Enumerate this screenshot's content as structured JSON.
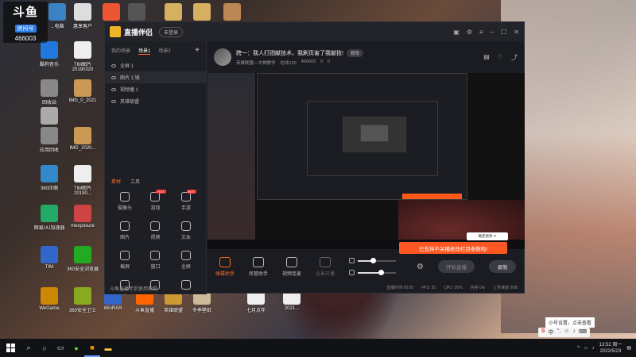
{
  "overlay": {
    "logo": "斗鱼",
    "room_label": "房间号",
    "room_number": "466003"
  },
  "desktop_icons": [
    {
      "label": "...电脑",
      "color": "#3b82c4"
    },
    {
      "label": "惠享客户",
      "color": "#ddd"
    },
    {
      "label": "",
      "color": "#e53"
    },
    {
      "label": "",
      "color": "#555"
    },
    {
      "label": "",
      "color": "#d4b060"
    },
    {
      "label": "",
      "color": "#d4b060"
    },
    {
      "label": "",
      "color": "#bb8855"
    },
    {
      "label": "酷狗音乐",
      "color": "#2277dd"
    },
    {
      "label": "TIM图片20190320",
      "color": "#eee"
    },
    {
      "label": "回收站",
      "color": "#888"
    },
    {
      "label": "IMG_0_2021",
      "color": "#cc9955"
    },
    {
      "label": "B码改变",
      "color": "#aaa"
    },
    {
      "label": "应用回收",
      "color": "#888"
    },
    {
      "label": "IMG_2020...",
      "color": "#cc9955"
    },
    {
      "label": "360压缩",
      "color": "#3388cc"
    },
    {
      "label": "TIM图片20190...",
      "color": "#eee"
    },
    {
      "label": "网易UU加速器",
      "color": "#2a6"
    },
    {
      "label": "mexposure",
      "color": "#c44"
    },
    {
      "label": "TIM",
      "color": "#36c"
    },
    {
      "label": "360安全浏览器",
      "color": "#2a2"
    },
    {
      "label": "WeGame",
      "color": "#c80"
    },
    {
      "label": "360安全卫士",
      "color": "#8a2"
    },
    {
      "label": "WinRAR",
      "color": "#36c"
    },
    {
      "label": "斗鱼直播",
      "color": "#f60"
    },
    {
      "label": "英雄联盟",
      "color": "#c93"
    },
    {
      "label": "冬季壁纸",
      "color": "#cb9"
    },
    {
      "label": "七月点年",
      "color": "#eee"
    },
    {
      "label": "2021...",
      "color": "#eee"
    }
  ],
  "app": {
    "title": "直播伴侣",
    "version": "未登录",
    "window_controls": [
      "toolbar-icon",
      "settings-icon",
      "menu-icon",
      "minimize-icon",
      "maximize-icon",
      "close-icon"
    ]
  },
  "scenes": {
    "tabs": [
      "我的场景",
      "场景1",
      "场景2"
    ],
    "active": 1,
    "add": "+"
  },
  "sources": [
    {
      "label": "全屏 1",
      "selected": false
    },
    {
      "label": "图片 1 镜",
      "selected": true
    },
    {
      "label": "视频播 1",
      "selected": false
    },
    {
      "label": "英雄联盟",
      "selected": false
    }
  ],
  "tool_tabs": [
    "素材",
    "工具"
  ],
  "tools": [
    {
      "label": "摄像头",
      "hot": ""
    },
    {
      "label": "游戏",
      "hot": "HOT"
    },
    {
      "label": "手游",
      "hot": "HOT"
    },
    {
      "label": "图片",
      "hot": ""
    },
    {
      "label": "视频",
      "hot": ""
    },
    {
      "label": "文本",
      "hot": ""
    },
    {
      "label": "截屏",
      "hot": ""
    },
    {
      "label": "窗口",
      "hot": ""
    },
    {
      "label": "全屏",
      "hot": ""
    },
    {
      "label": "...",
      "hot": ""
    },
    {
      "label": "...",
      "hot": ""
    },
    {
      "label": "...",
      "hot": ""
    }
  ],
  "left_status": "斗鱼直播伴侣使用教程",
  "stream": {
    "title": "跨一：我人打团献技术，我刷页害了我献技!",
    "modify": "修改",
    "meta": [
      "英雄联盟—大神教学",
      "在线120",
      "466003",
      "0",
      "0"
    ]
  },
  "preview": {
    "notice": "已支持不关播修改栏目参数啦!",
    "notice_box": "确定修改 ✕",
    "small_tooltip": "..."
  },
  "bottom_bar": {
    "items": [
      {
        "label": "弹幕助手",
        "state": "active"
      },
      {
        "label": "房管助手",
        "state": "normal"
      },
      {
        "label": "视频连麦",
        "state": "normal"
      },
      {
        "label": "全景开播",
        "state": "disabled"
      }
    ],
    "mic_level": 0.4,
    "speaker_level": 0.6,
    "start_live": "开始直播",
    "record": "录制"
  },
  "status_bar": [
    "直播时间 00:00",
    "FPS: 30",
    "CPU: 26%",
    "内存 0%",
    "上传速度 0KB"
  ],
  "taskbar": {
    "icons": [
      "search-icon",
      "cortana-icon",
      "taskview-icon",
      "360-icon",
      "douyu-icon",
      "explorer-icon"
    ],
    "tray": {
      "tooltip": "小号设置，点击查看",
      "ime": "中",
      "time": "13:52 周一",
      "date": "2022/5/23"
    }
  }
}
